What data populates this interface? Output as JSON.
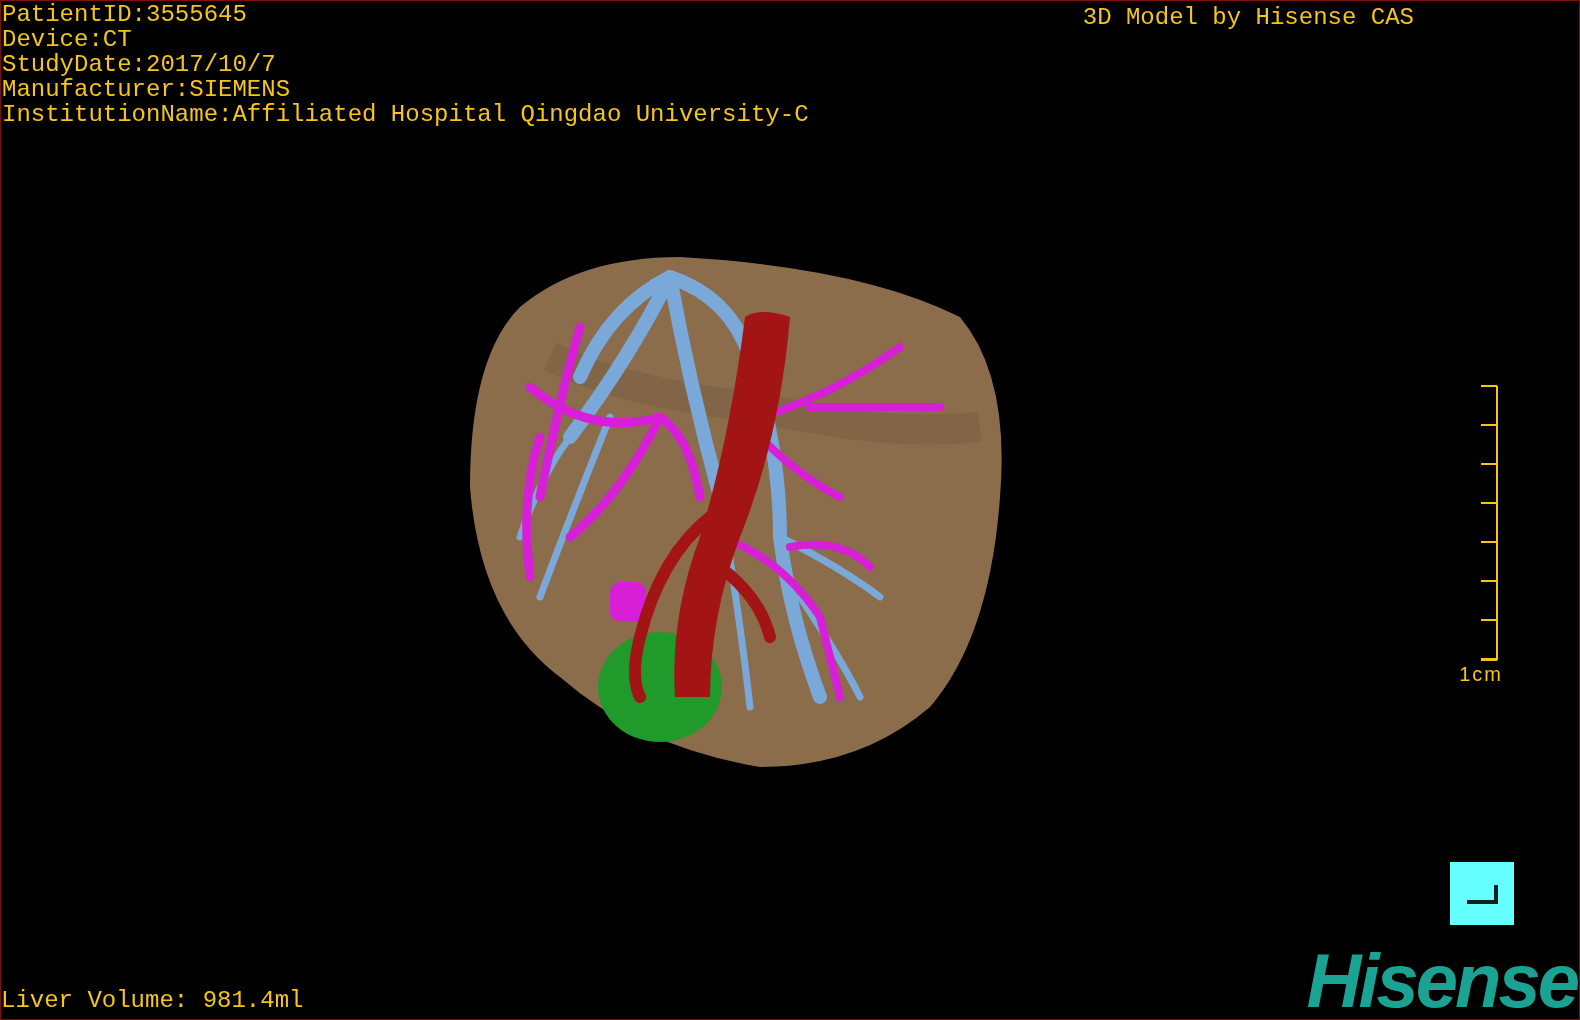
{
  "info_lines": [
    "PatientID:3555645",
    "Device:CT",
    "StudyDate:2017/10/7",
    "Manufacturer:SIEMENS",
    "InstitutionName:Affiliated Hospital Qingdao University-C"
  ],
  "title": "3D Model by Hisense CAS",
  "scale_bar": {
    "label": "1cm"
  },
  "liver_volume": "Liver Volume: 981.4ml",
  "logo": "Hisense"
}
